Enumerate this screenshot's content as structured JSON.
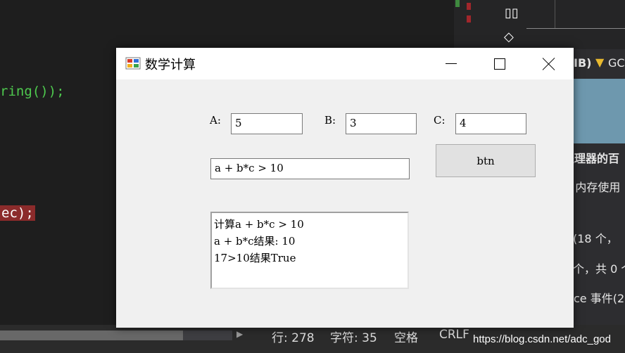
{
  "ide": {
    "code_lines": [
      "ring());",
      "ec);"
    ],
    "status": {
      "line": "行: 278",
      "char": "字符: 35",
      "spaces": "空格",
      "eol": "CRLF"
    },
    "right_panel": {
      "header_text": "IB)",
      "gc_text": "GC",
      "heading": "处理器的百",
      "memory": "内存使用",
      "events1": "(18 个，",
      "events2": "个，共 0 个",
      "events3": "ce 事件(2",
      "bottom": "内存使用",
      "graph_color": "#6e98ae"
    },
    "watermark": "https://blog.csdn.net/adc_god"
  },
  "window": {
    "title": "数学计算",
    "fields": {
      "a_label": "A:",
      "a_value": "5",
      "b_label": "B:",
      "b_value": "3",
      "c_label": "C:",
      "c_value": "4",
      "expression": "a + b*c > 10"
    },
    "button_label": "btn",
    "output_lines": [
      "计算a + b*c > 10",
      "a + b*c结果: 10",
      "17>10结果True"
    ]
  }
}
